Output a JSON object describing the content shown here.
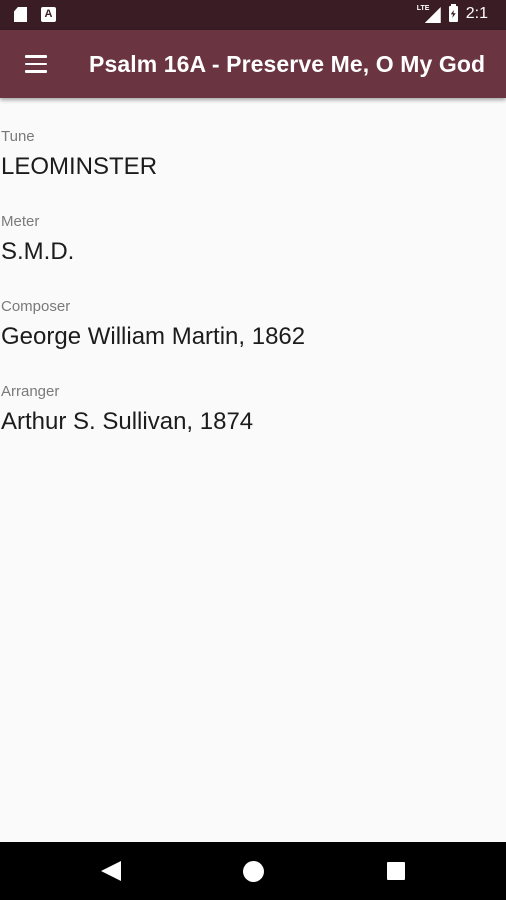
{
  "status_bar": {
    "time": "2:1",
    "network_label": "LTE",
    "icons": [
      "sd-card-icon",
      "a-notification-icon",
      "lte-signal-icon",
      "battery-charging-icon"
    ]
  },
  "app_bar": {
    "title": "Psalm 16A - Preserve Me, O My God",
    "menu_icon": "hamburger-menu-icon"
  },
  "details": [
    {
      "label": "Tune",
      "value": "LEOMINSTER"
    },
    {
      "label": "Meter",
      "value": "S.M.D."
    },
    {
      "label": "Composer",
      "value": "George William Martin, 1862"
    },
    {
      "label": "Arranger",
      "value": "Arthur S. Sullivan, 1874"
    }
  ],
  "nav_bar": {
    "icons": [
      "back-icon",
      "home-icon",
      "recents-icon"
    ]
  },
  "colors": {
    "status_bar": "#3a1c25",
    "app_bar": "#6b3441",
    "background": "#fafafa",
    "label": "#7a7a7a",
    "value": "#1c1c1c"
  }
}
